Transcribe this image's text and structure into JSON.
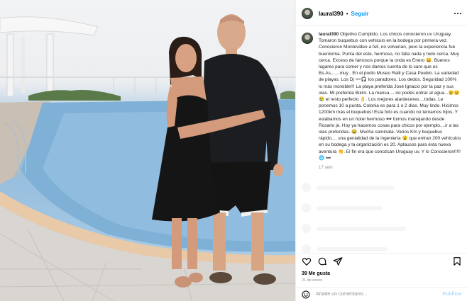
{
  "post": {
    "username": "laural390",
    "dot": "•",
    "follow_label": "Seguir",
    "caption_username": "laural390",
    "caption_text": "Objetivo Cumplido. Los chicos conocieron uv Uruguay. Tomaron buquebus con vehiculo en la bodega por primera vez. Conocieron Montevideo a full, no volverian, pero la experiencia fué buenisima. Punta del este, hermoso, no falta nada y todo cerca. Muy cerca. Exceso de famosos porque la onda es Enero 😀. Buenos lugares para comer y nos damos cuenta de lo caro que es Bs.As.......muy . En el podio Museo Ralli y Casa Pueblo. La variedad de playas. Los Dj 👓🎧 los paradores. Los dedos. Seguridad 100% lo más increible!!! La playa preferida José Ignacio por la paz y sus olas. Mi preferida Bikini. La mansa ....no podés entrar al agua...😢😢😢 el resto perfecto 👌. Los mejores atardeceres....todas. Le ponemos 10 a punta. Colonia es para 1 o 2 días. Muy lindo. Hicimos 1200km más el buquebus! Esta foto es cuando no teníamos hijos. Y estábamos en un hotel hermoso 🕶 fuimos manejando desde Rosario je. Hoy ya hacemos cosas para chicos por ejemplo....ir a las olas preferidas. 😂. Mucha caminata. Varios Km y buquebus rápido.... una genialidad de la ingeniería 😮 que entran 200 vehículos en su bodega y la organización es 20. Aplausos para ésta nueva aventura 👏. El fin era que conozcan Uruguay uv. Y lo Conocieron!!!!! 🌐 ➖",
    "age": "17 sem",
    "likes": "39 Me gusta",
    "date": "21 de enero",
    "comment_placeholder": "Añade un comentario...",
    "post_label": "Publicar"
  },
  "icons": [
    "more-icon",
    "heart-icon",
    "comment-icon",
    "share-icon",
    "bookmark-icon",
    "emoji-icon"
  ],
  "colors": {
    "accent": "#0095f6",
    "muted": "#8e8e8e",
    "post_disabled": "#b3dbff"
  }
}
